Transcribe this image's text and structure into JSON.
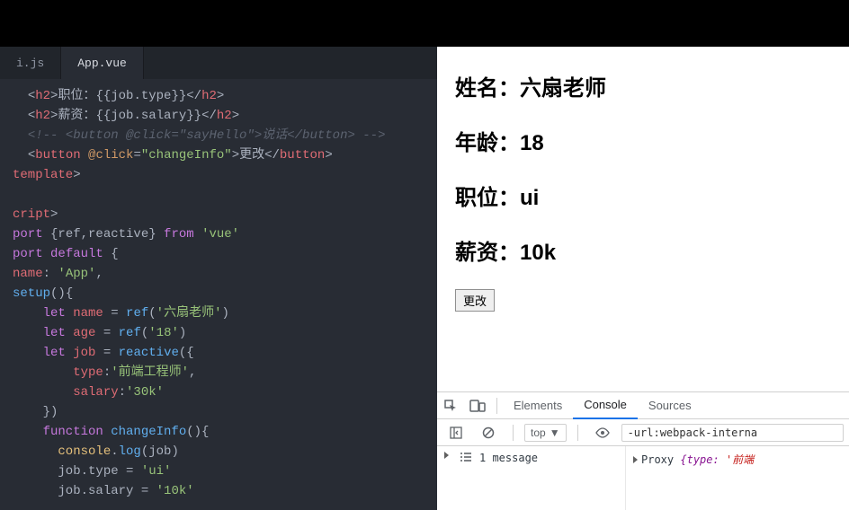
{
  "editor": {
    "tabs": [
      {
        "label": "i.js",
        "active": false
      },
      {
        "label": "App.vue",
        "active": true
      }
    ],
    "code": {
      "l1_a": "<",
      "l1_b": "h2",
      "l1_c": ">",
      "l1_d": "职位：",
      "l1_e": "{{job.type}}",
      "l1_f": "</",
      "l1_g": "h2",
      "l1_h": ">",
      "l2_a": "<",
      "l2_b": "h2",
      "l2_c": ">",
      "l2_d": "薪资：",
      "l2_e": "{{job.salary}}",
      "l2_f": "</",
      "l2_g": "h2",
      "l2_h": ">",
      "l3": "<!-- <button @click=\"sayHello\">说话</button> -->",
      "l4_a": "<",
      "l4_b": "button",
      "l4_c": " @click",
      "l4_d": "=",
      "l4_e": "\"changeInfo\"",
      "l4_f": ">",
      "l4_g": "更改",
      "l4_h": "</",
      "l4_i": "button",
      "l4_j": ">",
      "l5_a": "template",
      "l5_b": ">",
      "l6": "",
      "l7_a": "cript",
      "l7_b": ">",
      "l8_a": "port ",
      "l8_b": "{ref,reactive}",
      "l8_c": " from ",
      "l8_d": "'vue'",
      "l9_a": "port ",
      "l9_b": "default",
      "l9_c": " {",
      "l10_a": "name",
      "l10_b": ": ",
      "l10_c": "'App'",
      "l10_d": ",",
      "l11_a": "setup",
      "l11_b": "(){",
      "l12_a": "    let ",
      "l12_b": "name",
      "l12_c": " = ",
      "l12_d": "ref",
      "l12_e": "(",
      "l12_f": "'六扇老师'",
      "l12_g": ")",
      "l13_a": "    let ",
      "l13_b": "age",
      "l13_c": " = ",
      "l13_d": "ref",
      "l13_e": "(",
      "l13_f": "'18'",
      "l13_g": ")",
      "l14_a": "    let ",
      "l14_b": "job",
      "l14_c": " = ",
      "l14_d": "reactive",
      "l14_e": "({",
      "l15_a": "        type",
      "l15_b": ":",
      "l15_c": "'前端工程师'",
      "l15_d": ",",
      "l16_a": "        salary",
      "l16_b": ":",
      "l16_c": "'30k'",
      "l17": "    })",
      "l18_a": "    function ",
      "l18_b": "changeInfo",
      "l18_c": "(){",
      "l19_a": "      console",
      "l19_b": ".",
      "l19_c": "log",
      "l19_d": "(job)",
      "l20_a": "      job.type",
      "l20_b": " = ",
      "l20_c": "'ui'",
      "l21_a": "      job.salary",
      "l21_b": " = ",
      "l21_c": "'10k'"
    }
  },
  "page": {
    "name_label": "姓名：",
    "name_value": "六扇老师",
    "age_label": "年龄：",
    "age_value": "18",
    "job_label": "职位：",
    "job_value": "ui",
    "salary_label": "薪资：",
    "salary_value": "10k",
    "change_button": "更改"
  },
  "devtools": {
    "tabs": {
      "elements": "Elements",
      "console": "Console",
      "sources": "Sources"
    },
    "scope": "top",
    "filter_value": "-url:webpack-interna",
    "messages_count": "1 message",
    "log_line": {
      "prefix": "Proxy ",
      "brace_open": "{",
      "prop": "type",
      "colon": ": ",
      "str": "'前端",
      "trail": ""
    }
  }
}
